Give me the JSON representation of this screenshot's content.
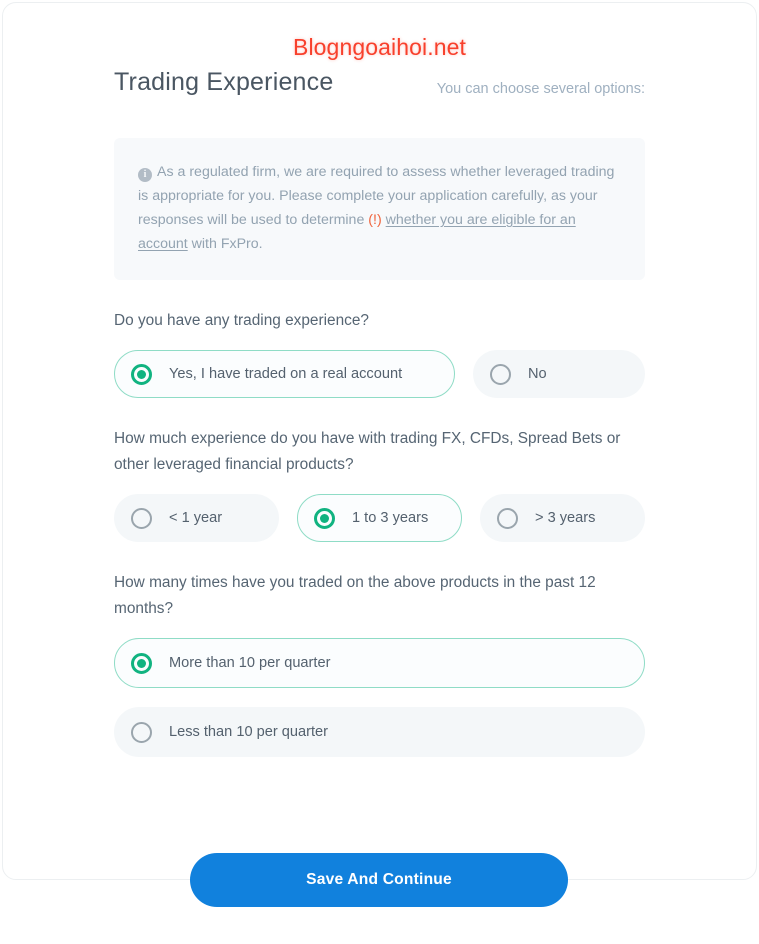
{
  "watermark": {
    "text": "Blogngoaihoi.net",
    "color": "#f8402c"
  },
  "header": {
    "title": "Trading Experience",
    "hint": "You can choose several options:"
  },
  "info": {
    "icon": "info-icon",
    "text_part1": "As a regulated firm, we are required to assess whether leveraged trading is appropriate for you. Please complete your application carefully, as your responses will be used to determine ",
    "warn_mark": "(!)",
    "link_text": "whether you are eligible for an account",
    "text_part2": " with FxPro."
  },
  "questions": [
    {
      "text": "Do you have any trading experience?",
      "layout": "row",
      "options": [
        {
          "label": "Yes, I have traded on a real account",
          "selected": true
        },
        {
          "label": "No",
          "selected": false
        }
      ]
    },
    {
      "text": "How much experience do you have with trading FX, CFDs, Spread Bets or other leveraged financial products?",
      "layout": "row",
      "options": [
        {
          "label": "< 1 year",
          "selected": false
        },
        {
          "label": "1 to 3 years",
          "selected": true
        },
        {
          "label": "> 3 years",
          "selected": false
        }
      ]
    },
    {
      "text": "How many times have you traded on the above products in the past 12 months?",
      "layout": "column",
      "options": [
        {
          "label": "More than 10 per quarter",
          "selected": true
        },
        {
          "label": "Less than 10 per quarter",
          "selected": false
        }
      ]
    }
  ],
  "submit": {
    "label": "Save And Continue",
    "color": "#1181dd"
  },
  "colors": {
    "accent_green": "#11b380",
    "selected_border": "#8fdcc6",
    "pill_bg": "#f4f7f9",
    "info_bg": "#f7f9fb",
    "warn": "#f0643c"
  }
}
